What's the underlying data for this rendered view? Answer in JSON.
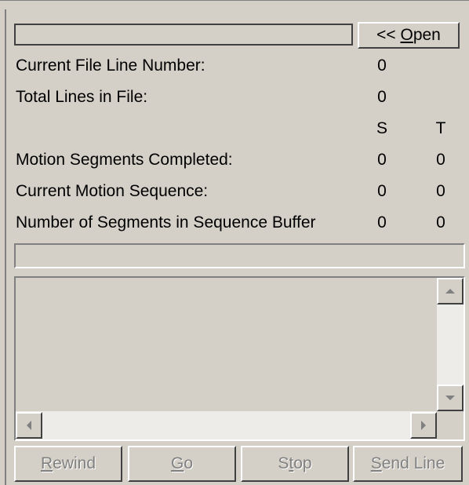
{
  "file": {
    "path_value": "",
    "open_button": {
      "prefix": "<< ",
      "mnemonic": "O",
      "rest": "pen"
    }
  },
  "status": {
    "current_line_label": "Current File Line Number:",
    "current_line_value": "0",
    "total_lines_label": "Total Lines in File:",
    "total_lines_value": "0",
    "col_s": "S",
    "col_t": "T",
    "rows": [
      {
        "label": "Motion Segments Completed:",
        "s": "0",
        "t": "0"
      },
      {
        "label": "Current Motion Sequence:",
        "s": "0",
        "t": "0"
      },
      {
        "label": "Number of Segments in Sequence Buffer",
        "s": "0",
        "t": "0"
      }
    ]
  },
  "buttons": {
    "rewind": {
      "mnemonic": "R",
      "rest": "ewind"
    },
    "go": {
      "mnemonic": "G",
      "rest": "o"
    },
    "stop": {
      "pre": "S",
      "mnemonic": "t",
      "rest": "op"
    },
    "send_line": {
      "mnemonic": "S",
      "rest": "end Line"
    }
  }
}
